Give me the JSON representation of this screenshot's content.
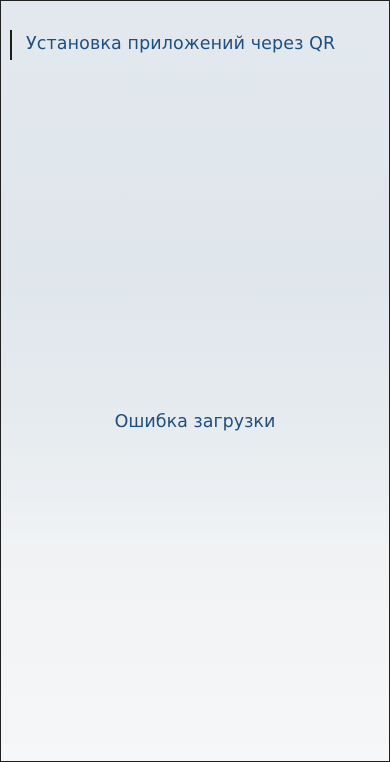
{
  "header": {
    "title": "Установка приложений через QR"
  },
  "main": {
    "status_message": "Ошибка загрузки"
  },
  "colors": {
    "text_accent": "#1f4f7e",
    "background_top": "#e2e8ee",
    "background_bottom": "#f6f7f8"
  }
}
